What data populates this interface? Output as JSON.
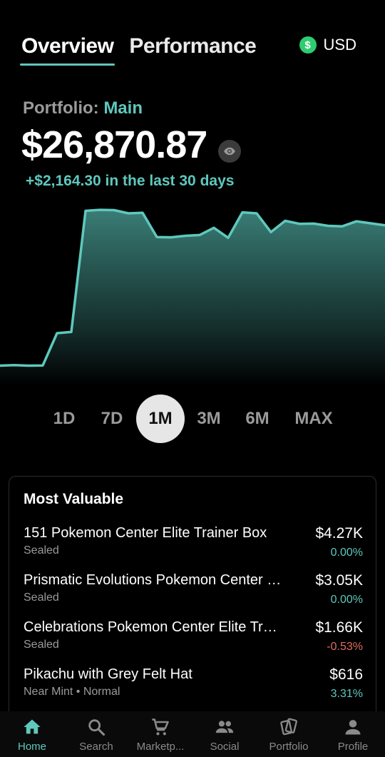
{
  "tabs": [
    {
      "label": "Overview",
      "active": true
    },
    {
      "label": "Performance",
      "active": false
    }
  ],
  "currency": {
    "symbol": "$",
    "code": "USD",
    "color": "#2ecc71"
  },
  "portfolio": {
    "label": "Portfolio:",
    "name": "Main"
  },
  "total_value": "$26,870.87",
  "change_text": "+$2,164.30 in the last 30 days",
  "accent_color": "#5ec8bd",
  "chart_data": {
    "type": "area",
    "y_values": [
      26250,
      26252,
      26250,
      26251,
      26380,
      26385,
      26870,
      26874,
      26873,
      26860,
      26862,
      26765,
      26764,
      26770,
      26773,
      26802,
      26762,
      26864,
      26860,
      26785,
      26830,
      26818,
      26819,
      26810,
      26808,
      26828,
      26820,
      26812
    ],
    "ylim": [
      26200,
      26900
    ],
    "grid": false,
    "color": "#5ec8bd"
  },
  "ranges": [
    {
      "label": "1D",
      "active": false
    },
    {
      "label": "7D",
      "active": false
    },
    {
      "label": "1M",
      "active": true
    },
    {
      "label": "3M",
      "active": false
    },
    {
      "label": "6M",
      "active": false
    },
    {
      "label": "MAX",
      "active": false
    }
  ],
  "most_valuable": {
    "title": "Most Valuable",
    "items": [
      {
        "name": "151 Pokemon Center Elite Trainer Box",
        "sub": "Sealed",
        "price": "$4.27K",
        "change": "0.00%",
        "direction": "flat"
      },
      {
        "name": "Prismatic Evolutions Pokemon Center Elite Trainer Box",
        "sub": "Sealed",
        "price": "$3.05K",
        "change": "0.00%",
        "direction": "flat"
      },
      {
        "name": "Celebrations Pokemon Center Elite Trainer Box",
        "sub": "Sealed",
        "price": "$1.66K",
        "change": "-0.53%",
        "direction": "down"
      },
      {
        "name": "Pikachu with Grey Felt Hat",
        "sub": "Near Mint • Normal",
        "price": "$616",
        "change": "3.31%",
        "direction": "up"
      }
    ]
  },
  "nav": [
    {
      "label": "Home",
      "icon": "home-icon",
      "active": true
    },
    {
      "label": "Search",
      "icon": "search-icon",
      "active": false
    },
    {
      "label": "Marketp...",
      "icon": "cart-icon",
      "active": false
    },
    {
      "label": "Social",
      "icon": "people-icon",
      "active": false
    },
    {
      "label": "Portfolio",
      "icon": "cards-icon",
      "active": false
    },
    {
      "label": "Profile",
      "icon": "person-icon",
      "active": false
    }
  ]
}
